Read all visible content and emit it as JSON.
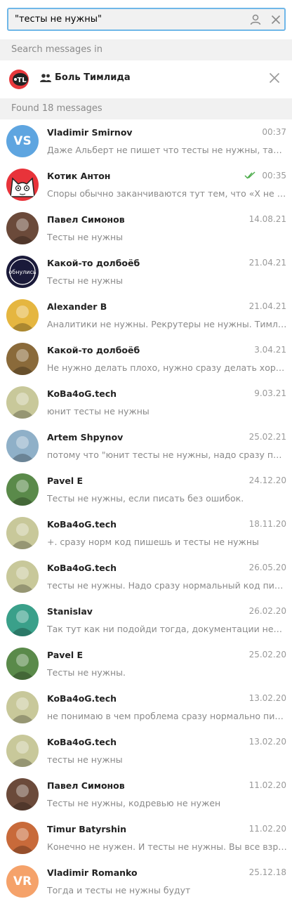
{
  "search": {
    "query": "\"тесты не нужны\""
  },
  "scope": {
    "header": "Search messages in",
    "chat_name": "Боль Тимлида"
  },
  "results_header": "Found 18 messages",
  "messages": [
    {
      "name": "Vladimir Smirnov",
      "date": "00:37",
      "snippet": "Даже Альберт не пишет что тесты не нужны, так что...",
      "avatar": "initials",
      "initials": "VS",
      "color": "#5ea5e0"
    },
    {
      "name": "Котик Антон",
      "date": "00:35",
      "snippet": "Споры обычно заканчиваются тут тем, что «X не ну...",
      "avatar": "cat",
      "read": true
    },
    {
      "name": "Павел Симонов",
      "date": "14.08.21",
      "snippet": "Тесты не нужны",
      "avatar": "photo",
      "color": "#6b4a3a"
    },
    {
      "name": "Какой-то долбоёб",
      "date": "21.04.21",
      "snippet": "Тесты не нужны",
      "avatar": "logo",
      "logo_text": "обнулись"
    },
    {
      "name": "Alexander B",
      "date": "21.04.21",
      "snippet": "Аналитики не нужны. Рекрутеры не нужны. Тимлид...",
      "avatar": "photo",
      "color": "#e5b640"
    },
    {
      "name": "Какой-то долбоёб",
      "date": "3.04.21",
      "snippet": "Не нужно делать плохо, нужно сразу делать хорошо...",
      "avatar": "photo",
      "color": "#8a6a3a"
    },
    {
      "name": "KoBa4oG.tech",
      "date": "9.03.21",
      "snippet": "юнит тесты не нужны",
      "avatar": "photo",
      "color": "#c8c89a"
    },
    {
      "name": "Artem Shpynov",
      "date": "25.02.21",
      "snippet": "потому что \"юнит тесты не нужны, надо сразу писат...",
      "avatar": "photo",
      "color": "#8fb0c8"
    },
    {
      "name": "Pavel E",
      "date": "24.12.20",
      "snippet": "Тесты не нужны, если писать без ошибок.",
      "avatar": "photo",
      "color": "#5a8a4a"
    },
    {
      "name": "KoBa4oG.tech",
      "date": "18.11.20",
      "snippet": "+. сразу норм код пишешь и тесты не нужны",
      "avatar": "photo",
      "color": "#c8c89a"
    },
    {
      "name": "KoBa4oG.tech",
      "date": "26.05.20",
      "snippet": "тесты не нужны. Надо сразу нормальный код писать",
      "avatar": "photo",
      "color": "#c8c89a"
    },
    {
      "name": "Stanislav",
      "date": "26.02.20",
      "snippet": "Так тут как ни подойди тогда, документации нет, по...",
      "avatar": "photo",
      "color": "#3aa08a"
    },
    {
      "name": "Pavel E",
      "date": "25.02.20",
      "snippet": "Тесты не нужны.",
      "avatar": "photo",
      "color": "#5a8a4a"
    },
    {
      "name": "KoBa4oG.tech",
      "date": "13.02.20",
      "snippet": "не понимаю в чем проблема сразу нормально писа...",
      "avatar": "photo",
      "color": "#c8c89a"
    },
    {
      "name": "KoBa4oG.tech",
      "date": "13.02.20",
      "snippet": "тесты не нужны",
      "avatar": "photo",
      "color": "#c8c89a"
    },
    {
      "name": "Павел Симонов",
      "date": "11.02.20",
      "snippet": "Тесты не нужны, кодревью не нужен",
      "avatar": "photo",
      "color": "#6b4a3a"
    },
    {
      "name": "Timur Batyrshin",
      "date": "11.02.20",
      "snippet": "Конечно не нужен. И тесты не нужны. Вы все взрос...",
      "avatar": "photo",
      "color": "#c86a3a"
    },
    {
      "name": "Vladimir Romanko",
      "date": "25.12.18",
      "snippet": "Тогда и тесты не нужны будут",
      "avatar": "initials",
      "initials": "VR",
      "color": "#f5a26a"
    }
  ],
  "icons": {
    "accent": "#6fb7e8",
    "read_check": "#4fae4e"
  }
}
